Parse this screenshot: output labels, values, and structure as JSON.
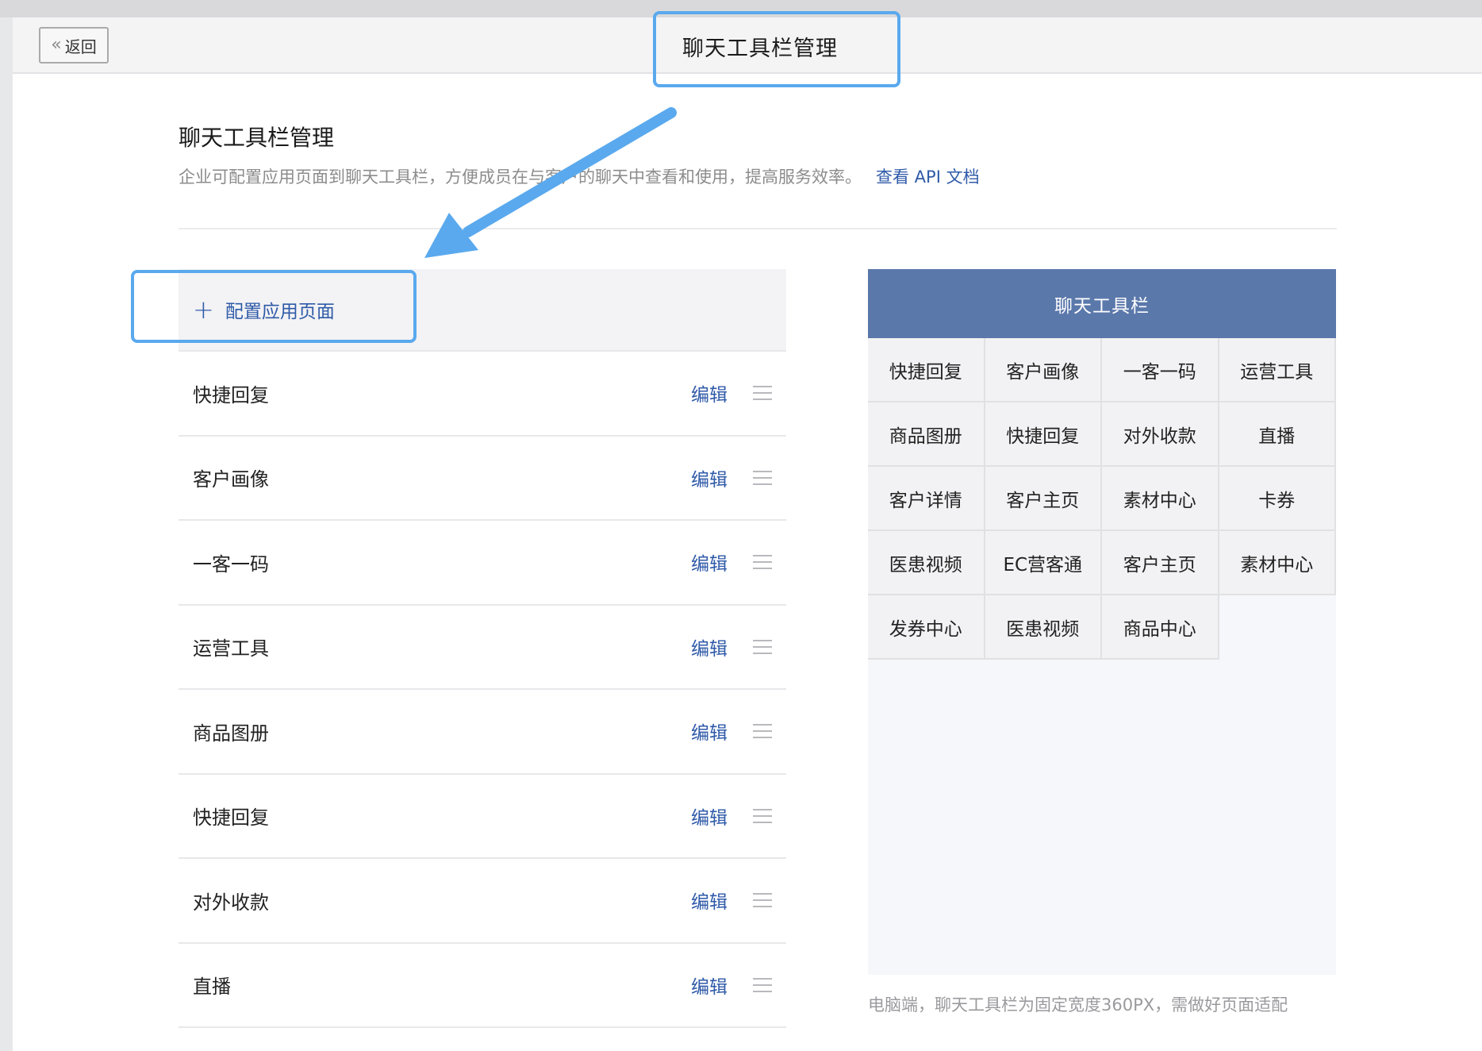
{
  "header": {
    "back_label": "返回",
    "title": "聊天工具栏管理"
  },
  "section": {
    "title": "聊天工具栏管理",
    "description": "企业可配置应用页面到聊天工具栏，方便成员在与客户的聊天中查看和使用，提高服务效率。",
    "api_link": "查看 API 文档"
  },
  "list": {
    "add_label": "配置应用页面",
    "edit_label": "编辑",
    "items": [
      {
        "name": "快捷回复"
      },
      {
        "name": "客户画像"
      },
      {
        "name": "一客一码"
      },
      {
        "name": "运营工具"
      },
      {
        "name": "商品图册"
      },
      {
        "name": "快捷回复"
      },
      {
        "name": "对外收款"
      },
      {
        "name": "直播"
      }
    ]
  },
  "preview": {
    "title": "聊天工具栏",
    "cells": [
      "快捷回复",
      "客户画像",
      "一客一码",
      "运营工具",
      "商品图册",
      "快捷回复",
      "对外收款",
      "直播",
      "客户详情",
      "客户主页",
      "素材中心",
      "卡券",
      "医患视频",
      "EC营客通",
      "客户主页",
      "素材中心",
      "发券中心",
      "医患视频",
      "商品中心"
    ],
    "note": "电脑端，聊天工具栏为固定宽度360PX，需做好页面适配"
  },
  "colors": {
    "accent": "#2f5aa8",
    "preview_header": "#5b78ab",
    "annotation": "#5aa9ee"
  },
  "icons": {
    "back": "double-chevron-left-icon",
    "add": "plus-icon",
    "drag": "drag-handle-icon",
    "annotation": "arrow-icon"
  }
}
